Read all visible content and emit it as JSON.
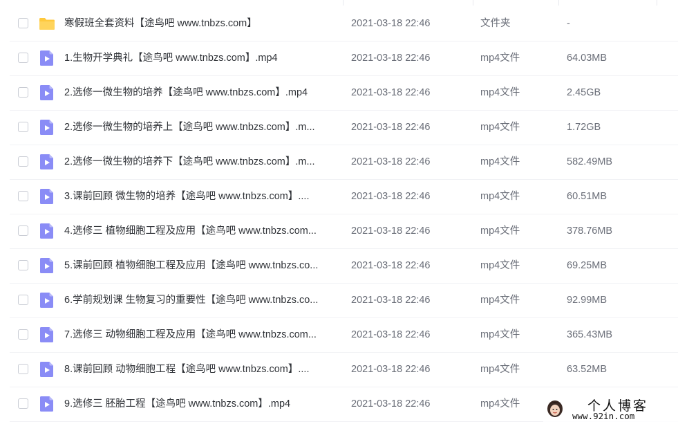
{
  "colors": {
    "folder": "#ffc93d",
    "video": "#8a8cf6"
  },
  "files": [
    {
      "icon": "folder-icon",
      "name": "寒假班全套资料【途鸟吧 www.tnbzs.com】",
      "date": "2021-03-18 22:46",
      "type": "文件夹",
      "size": "-"
    },
    {
      "icon": "video-file-icon",
      "name": "1.生物开学典礼【途鸟吧 www.tnbzs.com】.mp4",
      "date": "2021-03-18 22:46",
      "type": "mp4文件",
      "size": "64.03MB"
    },
    {
      "icon": "video-file-icon",
      "name": "2.选修一微生物的培养【途鸟吧 www.tnbzs.com】.mp4",
      "date": "2021-03-18 22:46",
      "type": "mp4文件",
      "size": "2.45GB"
    },
    {
      "icon": "video-file-icon",
      "name": "2.选修一微生物的培养上【途鸟吧 www.tnbzs.com】.m...",
      "date": "2021-03-18 22:46",
      "type": "mp4文件",
      "size": "1.72GB"
    },
    {
      "icon": "video-file-icon",
      "name": "2.选修一微生物的培养下【途鸟吧 www.tnbzs.com】.m...",
      "date": "2021-03-18 22:46",
      "type": "mp4文件",
      "size": "582.49MB"
    },
    {
      "icon": "video-file-icon",
      "name": "3.课前回顾 微生物的培养【途鸟吧 www.tnbzs.com】....",
      "date": "2021-03-18 22:46",
      "type": "mp4文件",
      "size": "60.51MB"
    },
    {
      "icon": "video-file-icon",
      "name": "4.选修三 植物细胞工程及应用【途鸟吧 www.tnbzs.com...",
      "date": "2021-03-18 22:46",
      "type": "mp4文件",
      "size": "378.76MB"
    },
    {
      "icon": "video-file-icon",
      "name": "5.课前回顾 植物细胞工程及应用【途鸟吧 www.tnbzs.co...",
      "date": "2021-03-18 22:46",
      "type": "mp4文件",
      "size": "69.25MB"
    },
    {
      "icon": "video-file-icon",
      "name": "6.学前规划课 生物复习的重要性【途鸟吧 www.tnbzs.co...",
      "date": "2021-03-18 22:46",
      "type": "mp4文件",
      "size": "92.99MB"
    },
    {
      "icon": "video-file-icon",
      "name": "7.选修三 动物细胞工程及应用【途鸟吧 www.tnbzs.com...",
      "date": "2021-03-18 22:46",
      "type": "mp4文件",
      "size": "365.43MB"
    },
    {
      "icon": "video-file-icon",
      "name": "8.课前回顾 动物细胞工程【途鸟吧 www.tnbzs.com】....",
      "date": "2021-03-18 22:46",
      "type": "mp4文件",
      "size": "63.52MB"
    },
    {
      "icon": "video-file-icon",
      "name": "9.选修三 胚胎工程【途鸟吧 www.tnbzs.com】.mp4",
      "date": "2021-03-18 22:46",
      "type": "mp4文件",
      "size": ""
    }
  ],
  "watermark": {
    "title": "个人博客",
    "url": "www.92in.com"
  }
}
